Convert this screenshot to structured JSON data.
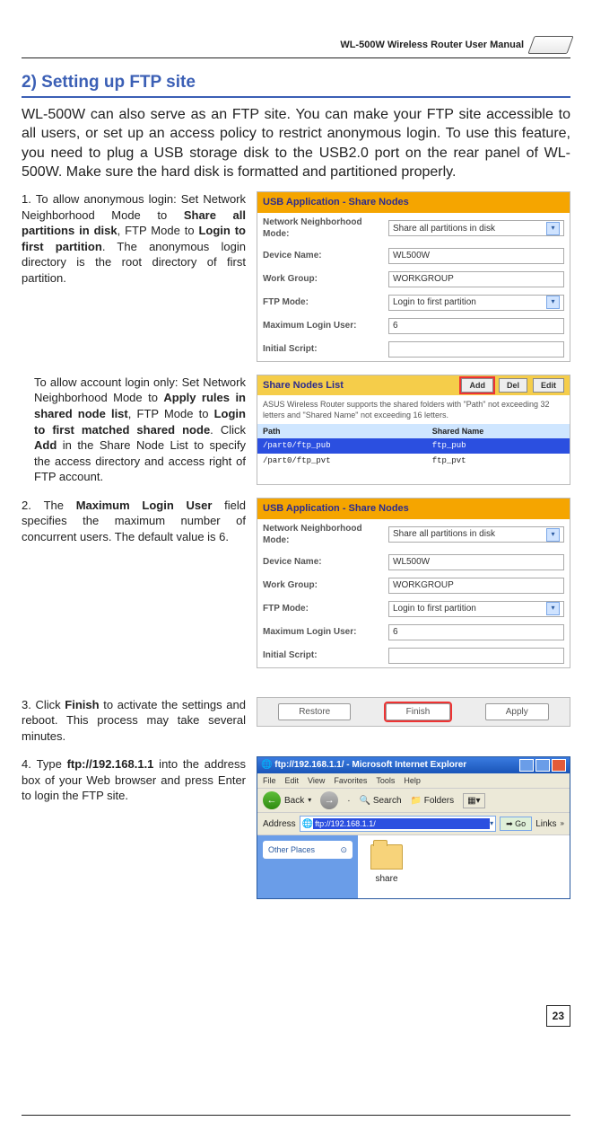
{
  "header": {
    "manual_title": "WL-500W Wireless Router User Manual"
  },
  "section": {
    "title": "2) Setting up FTP site"
  },
  "intro": "WL-500W can also serve as an FTP site. You can make your FTP site accessible to all users, or set up an access policy to restrict anonymous login. To use this feature, you need to plug a USB storage disk to the USB2.0 port on the rear panel of WL-500W. Make sure the hard disk is formatted and partitioned properly.",
  "steps": {
    "s1a_pre": "To allow anonymous login: Set Network Neighborhood Mode to ",
    "s1a_b1": "Share all partitions in disk",
    "s1a_mid1": ", FTP Mode to ",
    "s1a_b2": "Login to first partition",
    "s1a_post": ". The anonymous login directory is the root directory of first partition.",
    "s1b_pre": "To allow account login only: Set Network Neighborhood Mode to ",
    "s1b_b1": "Apply rules in shared node list",
    "s1b_mid1": ", FTP Mode to ",
    "s1b_b2": "Login to first matched shared node",
    "s1b_mid2": ". Click ",
    "s1b_b3": "Add",
    "s1b_post": " in the Share Node List to specify the access directory and access right of FTP account.",
    "s2_pre": "The ",
    "s2_b": "Maximum Login User",
    "s2_post": " field specifies the maximum number of concurrent users. The default value is 6.",
    "s3_pre": "Click ",
    "s3_b": "Finish",
    "s3_post": " to activate the settings and reboot. This process may take several minutes.",
    "s4_pre": "Type ",
    "s4_b": "ftp://192.168.1.1",
    "s4_post": " into the address box of your Web browser and press Enter to login the FTP site."
  },
  "panel1": {
    "title": "USB Application - Share Nodes",
    "labels": {
      "mode": "Network Neighborhood Mode:",
      "device": "Device Name:",
      "workgroup": "Work Group:",
      "ftpmode": "FTP Mode:",
      "maxuser": "Maximum Login User:",
      "script": "Initial Script:"
    },
    "values": {
      "mode": "Share all partitions in disk",
      "device": "WL500W",
      "workgroup": "WORKGROUP",
      "ftpmode": "Login to first partition",
      "maxuser": "6",
      "script": ""
    }
  },
  "sharelist": {
    "title": "Share Nodes List",
    "btn_add": "Add",
    "btn_del": "Del",
    "btn_edit": "Edit",
    "desc": "ASUS Wireless Router supports the shared folders with \"Path\" not exceeding 32 letters and \"Shared Name\" not exceeding 16 letters.",
    "col_path": "Path",
    "col_shared": "Shared Name",
    "rows": [
      {
        "path": "/part0/ftp_pub",
        "shared": "ftp_pub",
        "selected": true
      },
      {
        "path": "/part0/ftp_pvt",
        "shared": "ftp_pvt",
        "selected": false
      }
    ]
  },
  "btnbar": {
    "restore": "Restore",
    "finish": "Finish",
    "apply": "Apply"
  },
  "ie": {
    "title": "ftp://192.168.1.1/ - Microsoft Internet Explorer",
    "menu": {
      "file": "File",
      "edit": "Edit",
      "view": "View",
      "fav": "Favorites",
      "tools": "Tools",
      "help": "Help"
    },
    "toolbar": {
      "back": "Back",
      "search": "Search",
      "folders": "Folders"
    },
    "address_label": "Address",
    "address_value": "ftp://192.168.1.1/",
    "go": "Go",
    "links": "Links",
    "side": {
      "other": "Other Places"
    },
    "folder_name": "share"
  },
  "page_number": "23"
}
